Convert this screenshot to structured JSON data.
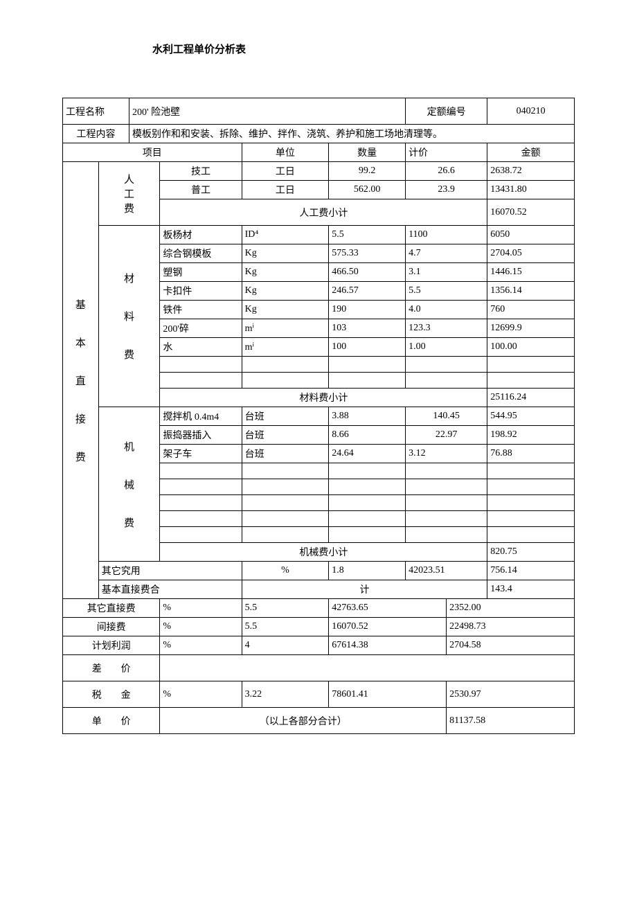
{
  "title": "水利工程单价分析表",
  "header": {
    "projNameLabel": "工程名称",
    "projName": "200' 险池壁",
    "quotaLabel": "定额编号",
    "quotaNo": "040210",
    "contentLabel": "工程内容",
    "content": "模板别作和和安装、拆除、维护、拌作、浇筑、养护和施工场地清理等。"
  },
  "cols": {
    "item": "项目",
    "unit": "单位",
    "qty": "数量",
    "price": "计价",
    "amount": "金额"
  },
  "bigLabel": {
    "l1": "基",
    "l2": "本",
    "l3": "直",
    "l4": "接",
    "l5": "费"
  },
  "labor": {
    "lab": {
      "l1": "人",
      "l2": "工",
      "l3": "费"
    },
    "rows": [
      {
        "name": "技工",
        "unit": "工日",
        "qty": "99.2",
        "price": "26.6",
        "amount": "2638.72"
      },
      {
        "name": "普工",
        "unit": "工日",
        "qty": "562.00",
        "price": "23.9",
        "amount": "13431.80"
      }
    ],
    "subtotalLabel": "人工费小计",
    "subtotal": "16070.52"
  },
  "material": {
    "lab": {
      "l1": "材",
      "l2": "料",
      "l3": "费"
    },
    "rows": [
      {
        "name": "板杨材",
        "unit": "ID⁴",
        "qty": "5.5",
        "price": "1100",
        "amount": "6050"
      },
      {
        "name": "综合钢模板",
        "unit": "Kg",
        "qty": "575.33",
        "price": "4.7",
        "amount": "2704.05"
      },
      {
        "name": "塑钢",
        "unit": "Kg",
        "qty": "466.50",
        "price": "3.1",
        "amount": "1446.15"
      },
      {
        "name": "卡扣件",
        "unit": "Kg",
        "qty": "246.57",
        "price": "5.5",
        "amount": "1356.14"
      },
      {
        "name": "铁件",
        "unit": "Kg",
        "qty": "190",
        "price": "4.0",
        "amount": "760"
      },
      {
        "name": "200'碎",
        "unit": "mⁱ",
        "qty": "103",
        "price": "123.3",
        "amount": "12699.9"
      },
      {
        "name": "水",
        "unit": "mⁱ",
        "qty": "100",
        "price": "1.00",
        "amount": "100.00"
      }
    ],
    "subtotalLabel": "材料费小计",
    "subtotal": "25116.24"
  },
  "machine": {
    "lab": {
      "l1": "机",
      "l2": "械",
      "l3": "费"
    },
    "rows": [
      {
        "name": "搅拌机 0.4m4",
        "unit": "台班",
        "qty": "3.88",
        "price": "140.45",
        "amount": "544.95"
      },
      {
        "name": "振捣器插入",
        "unit": "台班",
        "qty": "8.66",
        "price": "22.97",
        "amount": "198.92"
      },
      {
        "name": "架子车",
        "unit": "台班",
        "qty": "24.64",
        "price": "3.12",
        "amount": "76.88"
      }
    ],
    "subtotalLabel": "机械费小计",
    "subtotal": "820.75"
  },
  "otherFee": {
    "label": "其它究用",
    "unit": "%",
    "qty": "1.8",
    "base": "42023.51",
    "amount": "756.14"
  },
  "basicSum": {
    "label": "基本直接费合",
    "sumLabel": "计",
    "amount": "143.4"
  },
  "extra": [
    {
      "label": "其它直接费",
      "unit": "%",
      "qty": "5.5",
      "base": "42763.65",
      "amount": "2352.00"
    },
    {
      "label": "间接费",
      "unit": "%",
      "qty": "5.5",
      "base": "16070.52",
      "amount": "22498.73"
    },
    {
      "label": "计划利润",
      "unit": "%",
      "qty": "4",
      "base": "67614.38",
      "amount": "2704.58"
    }
  ],
  "diff": {
    "label": "差　　价"
  },
  "tax": {
    "label": "税　　金",
    "unit": "%",
    "qty": "3.22",
    "base": "78601.41",
    "amount": "2530.97"
  },
  "total": {
    "label": "单　　价",
    "sumLabel": "（以上各部分合计）",
    "amount": "81137.58"
  }
}
